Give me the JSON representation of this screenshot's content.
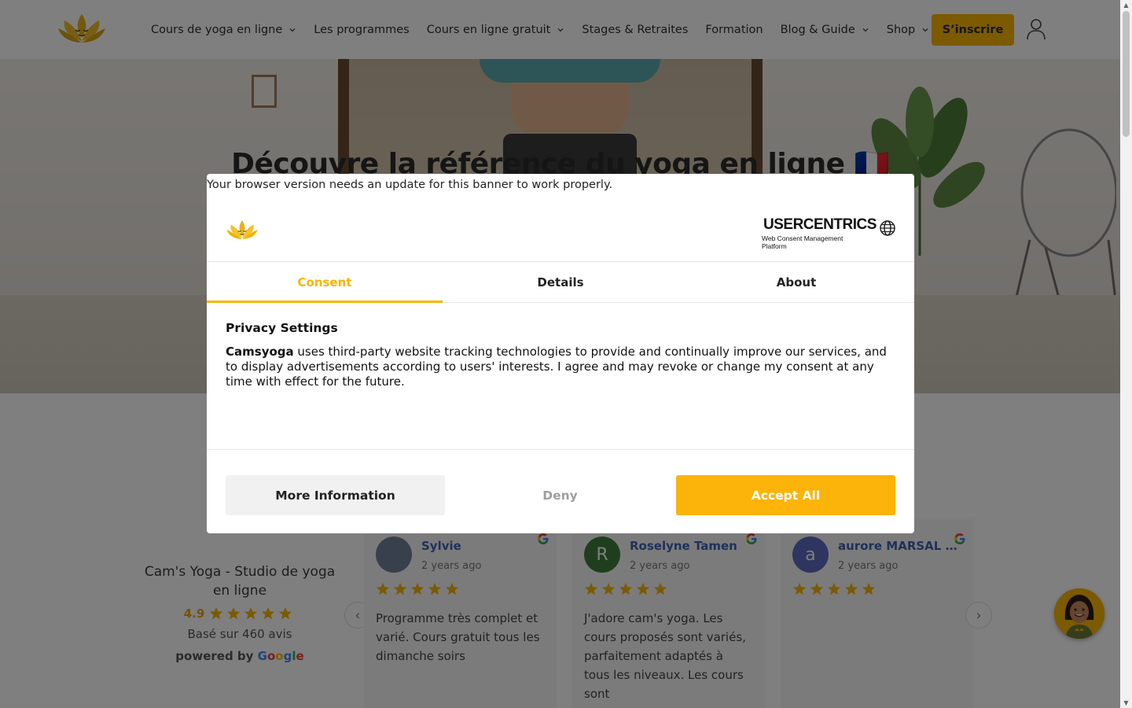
{
  "header": {
    "nav": [
      {
        "label": "Cours de yoga en ligne",
        "has_dropdown": true
      },
      {
        "label": "Les programmes",
        "has_dropdown": false
      },
      {
        "label": "Cours en ligne gratuit",
        "has_dropdown": true
      },
      {
        "label": "Stages & Retraites",
        "has_dropdown": false
      },
      {
        "label": "Formation",
        "has_dropdown": false
      },
      {
        "label": "Blog & Guide",
        "has_dropdown": true
      },
      {
        "label": "Shop",
        "has_dropdown": true
      }
    ],
    "cta_label": "S’inscrire",
    "icons": {
      "logo": "lotus-logo-icon",
      "account": "user-icon",
      "dropdown": "chevron-down-icon"
    }
  },
  "hero": {
    "title": "Découvre la référence du yoga en ligne 🇫🇷"
  },
  "reviews": {
    "business": {
      "name": "Cam's Yoga - Studio de yoga en ligne",
      "rating": "4.9",
      "stars": 5,
      "count_text": "Basé sur 460 avis",
      "powered_by": "powered by",
      "google_letters": [
        "G",
        "o",
        "o",
        "g",
        "l",
        "e"
      ]
    },
    "cards": [
      {
        "name": "Sylvie",
        "time": "2 years ago",
        "stars": 5,
        "text": "Programme très complet et varié. Cours gratuit tous les dimanche soirs",
        "avatar_letter": "",
        "avatar_color": "#7b8a9e"
      },
      {
        "name": "Roselyne Tamen",
        "time": "2 years ago",
        "stars": 5,
        "text": "J'adore cam's yoga. Les cours proposés sont variés, parfaitement adaptés à tous les niveaux. Les cours sont",
        "avatar_letter": "R",
        "avatar_color": "#3f7d3a"
      },
      {
        "name": "aurore MARSAL VI...",
        "time": "2 years ago",
        "stars": 5,
        "text": "",
        "avatar_letter": "a",
        "avatar_color": "#5c6bc0"
      }
    ],
    "prev_icon": "chevron-left-icon",
    "next_icon": "chevron-right-icon"
  },
  "consent": {
    "warning": "Your browser version needs an update for this banner to work properly.",
    "brand_title": "USERCENTRICS",
    "brand_subtitle": "Web Consent Management Platform",
    "tabs": [
      {
        "label": "Consent",
        "active": true
      },
      {
        "label": "Details",
        "active": false
      },
      {
        "label": "About",
        "active": false
      }
    ],
    "heading": "Privacy Settings",
    "company": "Camsyoga",
    "body": " uses third-party website tracking technologies to provide and continually improve our services, and to display advertisements according to users' interests. I agree and may revoke or change my consent at any time with effect for the future.",
    "buttons": {
      "more": "More Information",
      "deny": "Deny",
      "accept": "Accept All"
    }
  },
  "colors": {
    "brand_yellow": "#f7b500",
    "accept_button": "#fcb40a",
    "reviewer_name": "#3e63b2",
    "star": "#f7b500"
  }
}
